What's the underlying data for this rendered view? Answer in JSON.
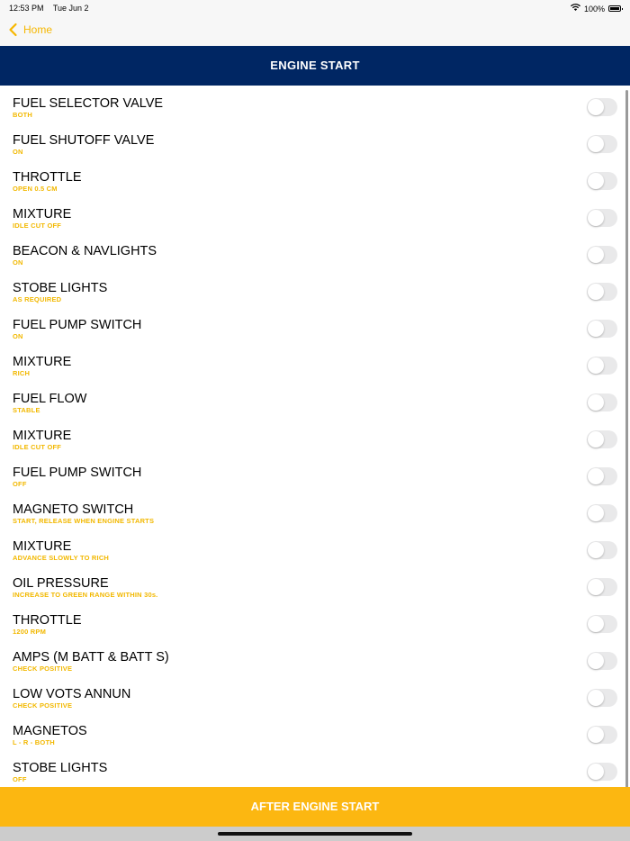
{
  "status_bar": {
    "time": "12:53 PM",
    "date": "Tue Jun 2",
    "battery": "100%"
  },
  "nav": {
    "back_label": "Home"
  },
  "title": "ENGINE START",
  "items": [
    {
      "title": "FUEL SELECTOR VALVE",
      "subtitle": "BOTH",
      "checked": false
    },
    {
      "title": "FUEL SHUTOFF VALVE",
      "subtitle": "ON",
      "checked": false
    },
    {
      "title": "THROTTLE",
      "subtitle": "OPEN 0.5 CM",
      "checked": false
    },
    {
      "title": "MIXTURE",
      "subtitle": "IDLE CUT OFF",
      "checked": false
    },
    {
      "title": "BEACON & NAVLIGHTS",
      "subtitle": "ON",
      "checked": false
    },
    {
      "title": "STOBE LIGHTS",
      "subtitle": "AS REQUIRED",
      "checked": false
    },
    {
      "title": "FUEL PUMP SWITCH",
      "subtitle": "ON",
      "checked": false
    },
    {
      "title": "MIXTURE",
      "subtitle": "RICH",
      "checked": false
    },
    {
      "title": "FUEL FLOW",
      "subtitle": "STABLE",
      "checked": false
    },
    {
      "title": "MIXTURE",
      "subtitle": "IDLE CUT OFF",
      "checked": false
    },
    {
      "title": "FUEL PUMP SWITCH",
      "subtitle": "OFF",
      "checked": false
    },
    {
      "title": "MAGNETO SWITCH",
      "subtitle": "START, RELEASE WHEN ENGINE STARTS",
      "checked": false
    },
    {
      "title": "MIXTURE",
      "subtitle": "ADVANCE SLOWLY TO RICH",
      "checked": false
    },
    {
      "title": "OIL PRESSURE",
      "subtitle": "INCREASE TO GREEN RANGE WITHIN 30s.",
      "checked": false
    },
    {
      "title": "THROTTLE",
      "subtitle": "1200 RPM",
      "checked": false
    },
    {
      "title": "AMPS (M BATT & BATT S)",
      "subtitle": "CHECK POSITIVE",
      "checked": false
    },
    {
      "title": "LOW VOTS ANNUN",
      "subtitle": "CHECK POSITIVE",
      "checked": false
    },
    {
      "title": "MAGNETOS",
      "subtitle": "L - R - BOTH",
      "checked": false
    },
    {
      "title": "STOBE LIGHTS",
      "subtitle": "OFF",
      "checked": false
    }
  ],
  "footer_button": "AFTER ENGINE START",
  "colors": {
    "title_bar": "#002663",
    "accent": "#F6B700",
    "footer_button": "#FCB711",
    "toggle_off": "#E9E9EA"
  }
}
